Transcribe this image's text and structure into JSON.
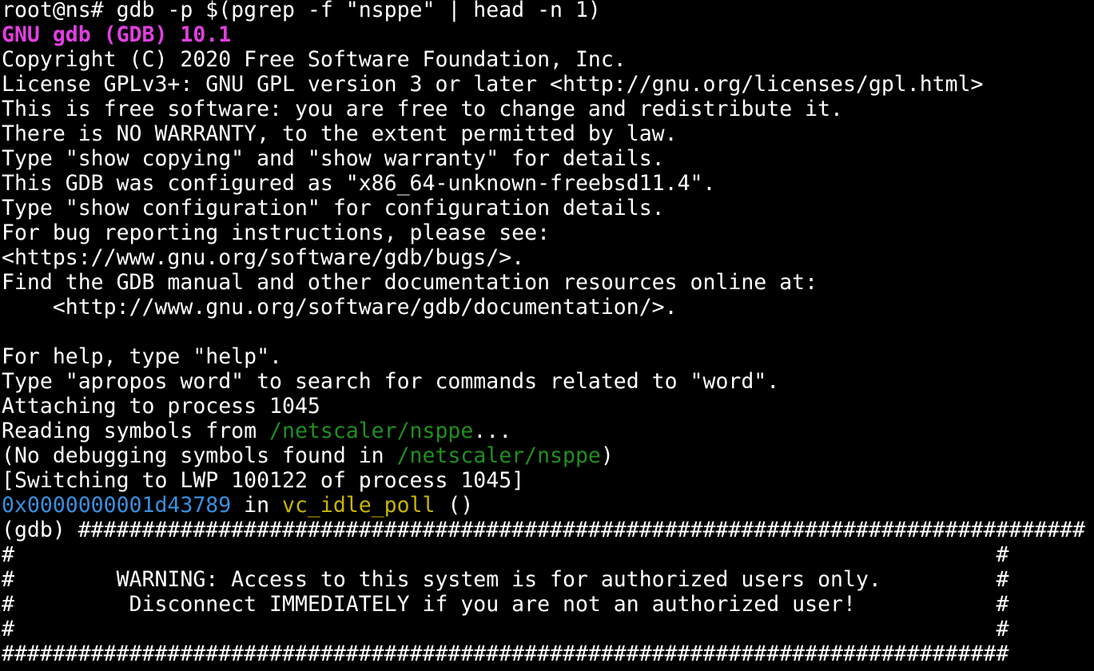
{
  "colors": {
    "background": "#000000",
    "text": "#ffffff",
    "banner": "#e040e0",
    "path": "#1f8f1f",
    "address": "#3a8fe0",
    "function": "#c8b400"
  },
  "lines": [
    [
      {
        "t": "root@ns# gdb -p $(pgrep -f \"nsppe\" | head -n 1)"
      }
    ],
    [
      {
        "t": "GNU gdb (GDB) 10.1",
        "c": "banner",
        "b": true
      }
    ],
    [
      {
        "t": "Copyright (C) 2020 Free Software Foundation, Inc."
      }
    ],
    [
      {
        "t": "License GPLv3+: GNU GPL version 3 or later <http://gnu.org/licenses/gpl.html>"
      }
    ],
    [
      {
        "t": "This is free software: you are free to change and redistribute it."
      }
    ],
    [
      {
        "t": "There is NO WARRANTY, to the extent permitted by law."
      }
    ],
    [
      {
        "t": "Type \"show copying\" and \"show warranty\" for details."
      }
    ],
    [
      {
        "t": "This GDB was configured as \"x86_64-unknown-freebsd11.4\"."
      }
    ],
    [
      {
        "t": "Type \"show configuration\" for configuration details."
      }
    ],
    [
      {
        "t": "For bug reporting instructions, please see:"
      }
    ],
    [
      {
        "t": "<https://www.gnu.org/software/gdb/bugs/>."
      }
    ],
    [
      {
        "t": "Find the GDB manual and other documentation resources online at:"
      }
    ],
    [
      {
        "t": "    <http://www.gnu.org/software/gdb/documentation/>."
      }
    ],
    [
      {
        "t": ""
      }
    ],
    [
      {
        "t": "For help, type \"help\"."
      }
    ],
    [
      {
        "t": "Type \"apropos word\" to search for commands related to \"word\"."
      }
    ],
    [
      {
        "t": "Attaching to process 1045"
      }
    ],
    [
      {
        "t": "Reading symbols from "
      },
      {
        "t": "/netscaler/nsppe",
        "c": "path"
      },
      {
        "t": "..."
      }
    ],
    [
      {
        "t": "(No debugging symbols found in "
      },
      {
        "t": "/netscaler/nsppe",
        "c": "path"
      },
      {
        "t": ")"
      }
    ],
    [
      {
        "t": "[Switching to LWP 100122 of process 1045]"
      }
    ],
    [
      {
        "t": "0x0000000001d43789",
        "c": "address"
      },
      {
        "t": " in "
      },
      {
        "t": "vc_idle_poll",
        "c": "function"
      },
      {
        "t": " ()"
      }
    ],
    [
      {
        "t": "(gdb) ###############################################################################"
      }
    ],
    [
      {
        "t": "#                                                                             #"
      }
    ],
    [
      {
        "t": "#        WARNING: Access to this system is for authorized users only.         #"
      }
    ],
    [
      {
        "t": "#         Disconnect IMMEDIATELY if you are not an authorized user!           #"
      }
    ],
    [
      {
        "t": "#                                                                             #"
      }
    ],
    [
      {
        "t": "###############################################################################"
      }
    ]
  ]
}
